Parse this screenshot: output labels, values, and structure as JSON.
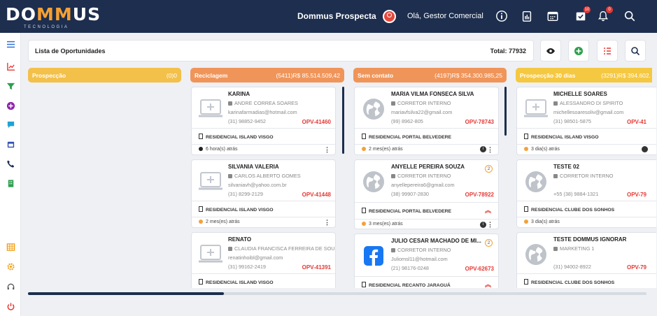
{
  "topbar": {
    "logo_text_a": "DO",
    "logo_text_m": "MM",
    "logo_text_b": "US",
    "logo_sub": "TECNOLOGIA",
    "app_title": "Dommus Prospecta",
    "greeting": "Olá, Gestor Comercial",
    "task_badge": "10",
    "notif_badge": "0"
  },
  "header": {
    "title": "Lista de Oportunidades",
    "total": "Total: 77932"
  },
  "columns": [
    {
      "label": "Prospecção",
      "count": "(0)0",
      "color": "#f3c04a"
    },
    {
      "label": "Reciclagem",
      "count": "(5411)R$ 85.514.509,42",
      "color": "#f0955a"
    },
    {
      "label": "Sem contato",
      "count": "(4197)R$ 354.300.985,25",
      "color": "#f0955a"
    },
    {
      "label": "Prospecção 30 dias",
      "count": "(3291)R$ 394.602.",
      "color": "#f5c842"
    }
  ],
  "cards": {
    "c1": {
      "name": "KARINA",
      "resp": "ANDRE CORREA SOARES",
      "email": "karinafarmadias@hotmail.com",
      "phone": "(31) 98852-9452",
      "opv": "OPV-41460",
      "emp": "RESIDENCIAL ISLAND VISGO",
      "time": "6 hora(s) atrás"
    },
    "c2": {
      "name": "SILVANIA VALERIA",
      "resp": "CARLOS ALBERTO GOMES",
      "email": "silvaniavh@yahoo.com.br",
      "phone": "(31) 8299-2129",
      "opv": "OPV-41448",
      "emp": "RESIDENCIAL ISLAND VISGO",
      "time": "2 mes(es) atrás"
    },
    "c3": {
      "name": "RENATO",
      "resp": "CLAUDIA FRANCISCA FERREIRA DE SOUZA",
      "email": "renatinhoibl@gmail.com",
      "phone": "(31) 99162-2419",
      "opv": "OPV-41391",
      "emp": "RESIDENCIAL ISLAND VISGO"
    },
    "c4": {
      "name": "MARIA VILMA FONSECA SILVA",
      "resp": "CORRETOR INTERNO",
      "email": "mariavfsilva22@gmail.com",
      "phone": "(99) 8962-805",
      "opv": "OPV-78743",
      "emp": "RESIDENCIAL PORTAL BELVEDERE",
      "time": "2 mes(es) atrás",
      "info": "i"
    },
    "c5": {
      "name": "ANYELLE PEREIRA SOUZA",
      "resp": "CORRETOR INTERNO",
      "email": "anyellepereira6@gmail.com",
      "phone": "(38) 99907-2830",
      "opv": "OPV-78922",
      "emp": "RESIDENCIAL PORTAL BELVEDERE",
      "time": "3 mes(es) atrás",
      "tag": "2",
      "info": "i"
    },
    "c6": {
      "name": "JULIO CESAR MACHADO DE MI...",
      "resp": "CORRETOR INTERNO",
      "email": "Juliomsl11@hotmail.com",
      "phone": "(21) 98176-0248",
      "opv": "OPV-62673",
      "emp": "RESIDENCIAL RECANTO JARAGUÁ",
      "tag": "2"
    },
    "c7": {
      "name": "MICHELLE SOARES",
      "resp": "ALESSANDRO DI SPIRITO",
      "email": "michellesoaresoliv@gmail.com",
      "phone": "(31) 98501-5875",
      "opv": "OPV-41",
      "emp": "RESIDENCIAL ISLAND VISGO",
      "time": "3 dia(s) atrás"
    },
    "c8": {
      "name": "TESTE 02",
      "resp": "CORRETOR INTERNO",
      "phone": "+55 (38) 9884-1321",
      "opv": "OPV-79",
      "emp": "RESIDENCIAL CLUBE DOS SONHOS",
      "time": "3 dia(s) atrás"
    },
    "c9": {
      "name": "TESTE DOMMUS IGNORAR",
      "resp": "MARKETING 1",
      "phone": "(31) 94002-8922",
      "opv": "OPV-79",
      "emp": "RESIDENCIAL CLUBE DOS SONHOS"
    }
  }
}
